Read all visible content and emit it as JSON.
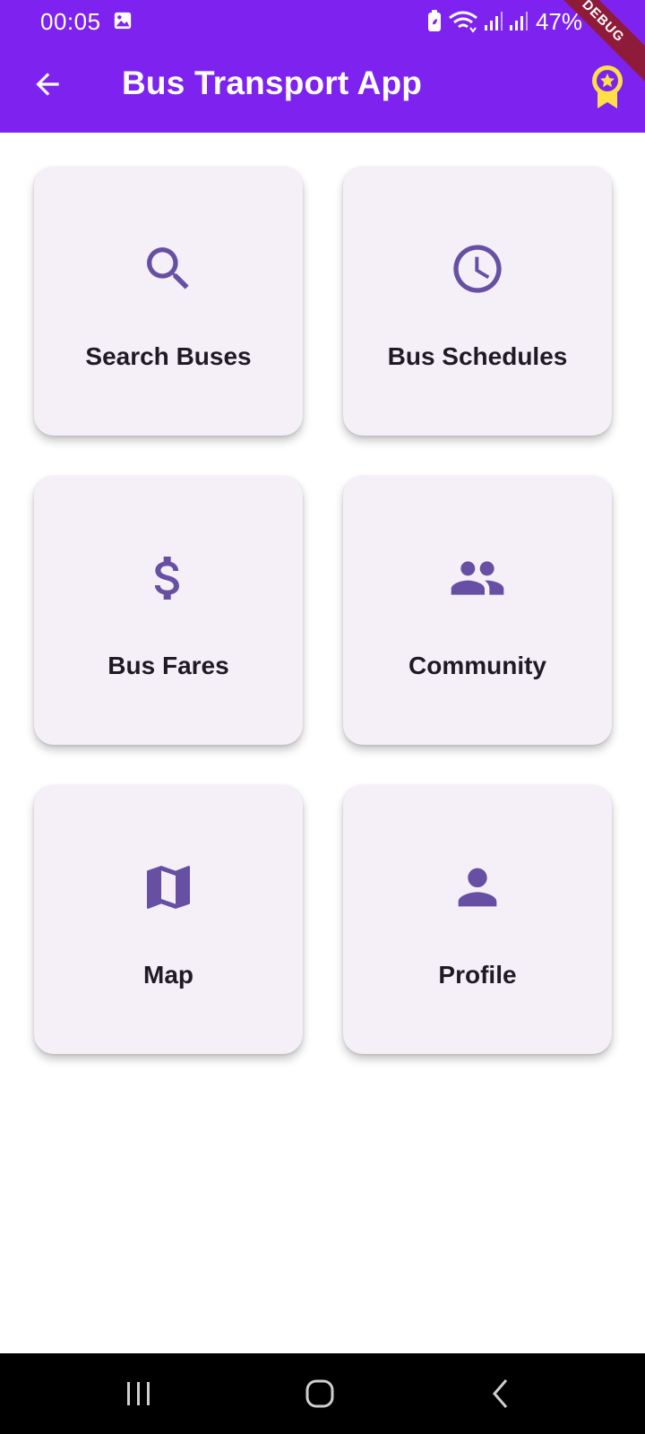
{
  "status_bar": {
    "time": "00:05",
    "battery": "47%"
  },
  "app_bar": {
    "title": "Bus Transport App",
    "debug_banner": "DEBUG"
  },
  "menu": [
    {
      "label": "Search Buses",
      "icon": "search-icon"
    },
    {
      "label": "Bus Schedules",
      "icon": "clock-icon"
    },
    {
      "label": "Bus Fares",
      "icon": "dollar-icon"
    },
    {
      "label": "Community",
      "icon": "people-icon"
    },
    {
      "label": "Map",
      "icon": "map-icon"
    },
    {
      "label": "Profile",
      "icon": "person-icon"
    }
  ],
  "colors": {
    "app_bar": "#7e22f0",
    "card_background": "#f5f0f8",
    "icon": "#6750a4",
    "award": "#fde047",
    "debug_ribbon": "#8e1b3a"
  }
}
